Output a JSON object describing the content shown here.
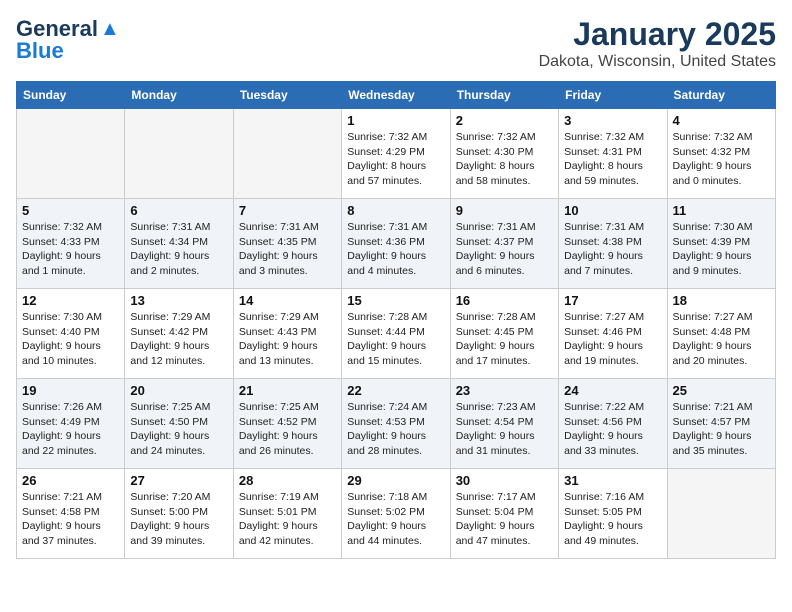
{
  "header": {
    "logo_line1": "General",
    "logo_line2": "Blue",
    "month": "January 2025",
    "location": "Dakota, Wisconsin, United States"
  },
  "weekdays": [
    "Sunday",
    "Monday",
    "Tuesday",
    "Wednesday",
    "Thursday",
    "Friday",
    "Saturday"
  ],
  "weeks": [
    [
      {
        "day": "",
        "info": ""
      },
      {
        "day": "",
        "info": ""
      },
      {
        "day": "",
        "info": ""
      },
      {
        "day": "1",
        "info": "Sunrise: 7:32 AM\nSunset: 4:29 PM\nDaylight: 8 hours and 57 minutes."
      },
      {
        "day": "2",
        "info": "Sunrise: 7:32 AM\nSunset: 4:30 PM\nDaylight: 8 hours and 58 minutes."
      },
      {
        "day": "3",
        "info": "Sunrise: 7:32 AM\nSunset: 4:31 PM\nDaylight: 8 hours and 59 minutes."
      },
      {
        "day": "4",
        "info": "Sunrise: 7:32 AM\nSunset: 4:32 PM\nDaylight: 9 hours and 0 minutes."
      }
    ],
    [
      {
        "day": "5",
        "info": "Sunrise: 7:32 AM\nSunset: 4:33 PM\nDaylight: 9 hours and 1 minute."
      },
      {
        "day": "6",
        "info": "Sunrise: 7:31 AM\nSunset: 4:34 PM\nDaylight: 9 hours and 2 minutes."
      },
      {
        "day": "7",
        "info": "Sunrise: 7:31 AM\nSunset: 4:35 PM\nDaylight: 9 hours and 3 minutes."
      },
      {
        "day": "8",
        "info": "Sunrise: 7:31 AM\nSunset: 4:36 PM\nDaylight: 9 hours and 4 minutes."
      },
      {
        "day": "9",
        "info": "Sunrise: 7:31 AM\nSunset: 4:37 PM\nDaylight: 9 hours and 6 minutes."
      },
      {
        "day": "10",
        "info": "Sunrise: 7:31 AM\nSunset: 4:38 PM\nDaylight: 9 hours and 7 minutes."
      },
      {
        "day": "11",
        "info": "Sunrise: 7:30 AM\nSunset: 4:39 PM\nDaylight: 9 hours and 9 minutes."
      }
    ],
    [
      {
        "day": "12",
        "info": "Sunrise: 7:30 AM\nSunset: 4:40 PM\nDaylight: 9 hours and 10 minutes."
      },
      {
        "day": "13",
        "info": "Sunrise: 7:29 AM\nSunset: 4:42 PM\nDaylight: 9 hours and 12 minutes."
      },
      {
        "day": "14",
        "info": "Sunrise: 7:29 AM\nSunset: 4:43 PM\nDaylight: 9 hours and 13 minutes."
      },
      {
        "day": "15",
        "info": "Sunrise: 7:28 AM\nSunset: 4:44 PM\nDaylight: 9 hours and 15 minutes."
      },
      {
        "day": "16",
        "info": "Sunrise: 7:28 AM\nSunset: 4:45 PM\nDaylight: 9 hours and 17 minutes."
      },
      {
        "day": "17",
        "info": "Sunrise: 7:27 AM\nSunset: 4:46 PM\nDaylight: 9 hours and 19 minutes."
      },
      {
        "day": "18",
        "info": "Sunrise: 7:27 AM\nSunset: 4:48 PM\nDaylight: 9 hours and 20 minutes."
      }
    ],
    [
      {
        "day": "19",
        "info": "Sunrise: 7:26 AM\nSunset: 4:49 PM\nDaylight: 9 hours and 22 minutes."
      },
      {
        "day": "20",
        "info": "Sunrise: 7:25 AM\nSunset: 4:50 PM\nDaylight: 9 hours and 24 minutes."
      },
      {
        "day": "21",
        "info": "Sunrise: 7:25 AM\nSunset: 4:52 PM\nDaylight: 9 hours and 26 minutes."
      },
      {
        "day": "22",
        "info": "Sunrise: 7:24 AM\nSunset: 4:53 PM\nDaylight: 9 hours and 28 minutes."
      },
      {
        "day": "23",
        "info": "Sunrise: 7:23 AM\nSunset: 4:54 PM\nDaylight: 9 hours and 31 minutes."
      },
      {
        "day": "24",
        "info": "Sunrise: 7:22 AM\nSunset: 4:56 PM\nDaylight: 9 hours and 33 minutes."
      },
      {
        "day": "25",
        "info": "Sunrise: 7:21 AM\nSunset: 4:57 PM\nDaylight: 9 hours and 35 minutes."
      }
    ],
    [
      {
        "day": "26",
        "info": "Sunrise: 7:21 AM\nSunset: 4:58 PM\nDaylight: 9 hours and 37 minutes."
      },
      {
        "day": "27",
        "info": "Sunrise: 7:20 AM\nSunset: 5:00 PM\nDaylight: 9 hours and 39 minutes."
      },
      {
        "day": "28",
        "info": "Sunrise: 7:19 AM\nSunset: 5:01 PM\nDaylight: 9 hours and 42 minutes."
      },
      {
        "day": "29",
        "info": "Sunrise: 7:18 AM\nSunset: 5:02 PM\nDaylight: 9 hours and 44 minutes."
      },
      {
        "day": "30",
        "info": "Sunrise: 7:17 AM\nSunset: 5:04 PM\nDaylight: 9 hours and 47 minutes."
      },
      {
        "day": "31",
        "info": "Sunrise: 7:16 AM\nSunset: 5:05 PM\nDaylight: 9 hours and 49 minutes."
      },
      {
        "day": "",
        "info": ""
      }
    ]
  ]
}
